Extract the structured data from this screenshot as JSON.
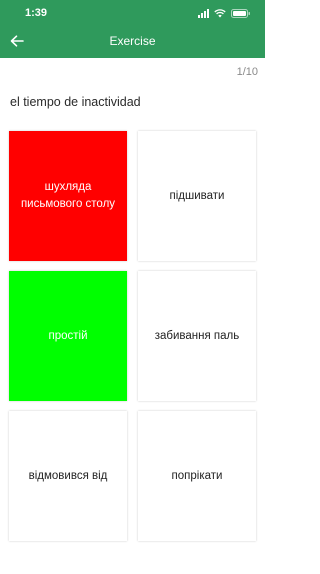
{
  "status_bar": {
    "time": "1:39"
  },
  "nav": {
    "title": "Exercise"
  },
  "exercise": {
    "progress": "1/10",
    "prompt": "el tiempo de inactividad",
    "options": [
      {
        "label": "шухляда письмового столу",
        "state": "wrong",
        "color": "#ff0000"
      },
      {
        "label": "підшивати",
        "state": "neutral",
        "color": "#ffffff"
      },
      {
        "label": "простій",
        "state": "correct",
        "color": "#00ff00"
      },
      {
        "label": "забивання паль",
        "state": "neutral",
        "color": "#ffffff"
      },
      {
        "label": "відмовився від",
        "state": "neutral",
        "color": "#ffffff"
      },
      {
        "label": "попрікати",
        "state": "neutral",
        "color": "#ffffff"
      }
    ]
  },
  "colors": {
    "header": "#2f9a5c",
    "wrong": "#ff0000",
    "correct": "#00ff00"
  }
}
